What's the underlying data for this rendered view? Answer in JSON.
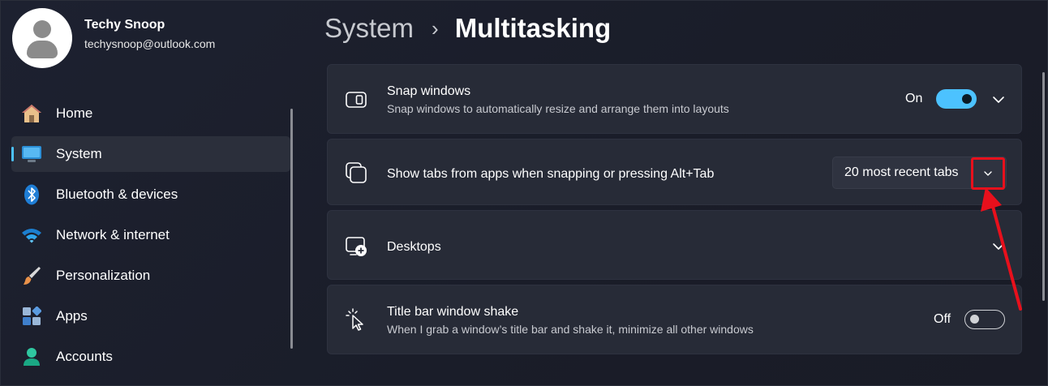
{
  "profile": {
    "name": "Techy Snoop",
    "email": "techysnoop@outlook.com"
  },
  "nav": {
    "items": [
      {
        "label": "Home",
        "icon": "home-icon"
      },
      {
        "label": "System",
        "icon": "system-icon",
        "selected": true
      },
      {
        "label": "Bluetooth & devices",
        "icon": "bluetooth-icon"
      },
      {
        "label": "Network & internet",
        "icon": "wifi-icon"
      },
      {
        "label": "Personalization",
        "icon": "brush-icon"
      },
      {
        "label": "Apps",
        "icon": "apps-icon"
      },
      {
        "label": "Accounts",
        "icon": "accounts-icon"
      }
    ]
  },
  "breadcrumb": {
    "parent": "System",
    "separator": "›",
    "current": "Multitasking"
  },
  "settings": {
    "snap": {
      "title": "Snap windows",
      "description": "Snap windows to automatically resize and arrange them into layouts",
      "state_label": "On",
      "icon": "snap-windows-icon"
    },
    "tabs": {
      "title": "Show tabs from apps when snapping or pressing Alt+Tab",
      "dropdown_value": "20 most recent tabs",
      "icon": "tabs-icon"
    },
    "desktops": {
      "title": "Desktops",
      "icon": "desktops-icon"
    },
    "shake": {
      "title": "Title bar window shake",
      "description": "When I grab a window’s title bar and shake it, minimize all other windows",
      "state_label": "Off",
      "icon": "window-shake-icon"
    }
  },
  "colors": {
    "accent": "#4cc2ff",
    "annotation": "#e8101c",
    "card": "#272b37",
    "background": "#1a1e2b"
  }
}
